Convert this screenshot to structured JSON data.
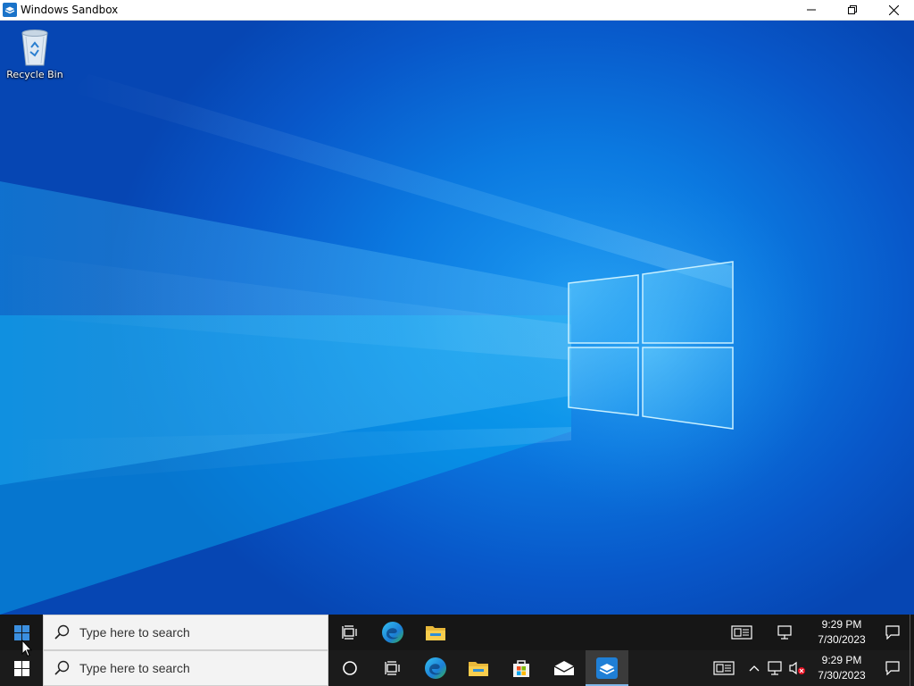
{
  "window": {
    "title": "Windows Sandbox",
    "controls": [
      "minimize-icon",
      "restore-icon",
      "close-icon"
    ]
  },
  "desktop": {
    "wallpaper": "windows-10-light-logo",
    "icons": [
      {
        "label": "Recycle Bin",
        "icon": "recycle-bin-icon"
      }
    ]
  },
  "taskbar_inner": {
    "search_placeholder": "Type here to search",
    "pinned": [
      "task-view-icon",
      "edge-icon",
      "file-explorer-icon"
    ],
    "tray": [
      "news-icon",
      "network-icon"
    ],
    "time": "9:29 PM",
    "date": "7/30/2023"
  },
  "taskbar_host": {
    "search_placeholder": "Type here to search",
    "pinned": [
      "cortana-icon",
      "task-view-icon",
      "edge-icon",
      "file-explorer-icon",
      "store-icon",
      "mail-icon",
      "windows-sandbox-icon"
    ],
    "active_app": "windows-sandbox-icon",
    "tray": [
      "news-icon",
      "chevron-up-icon",
      "network-icon",
      "volume-muted-icon"
    ],
    "time": "9:29 PM",
    "date": "7/30/2023"
  },
  "colors": {
    "accent": "#0078d7",
    "taskbar": "#1b1b1b",
    "desktop_blue": "#0a6fd8"
  }
}
